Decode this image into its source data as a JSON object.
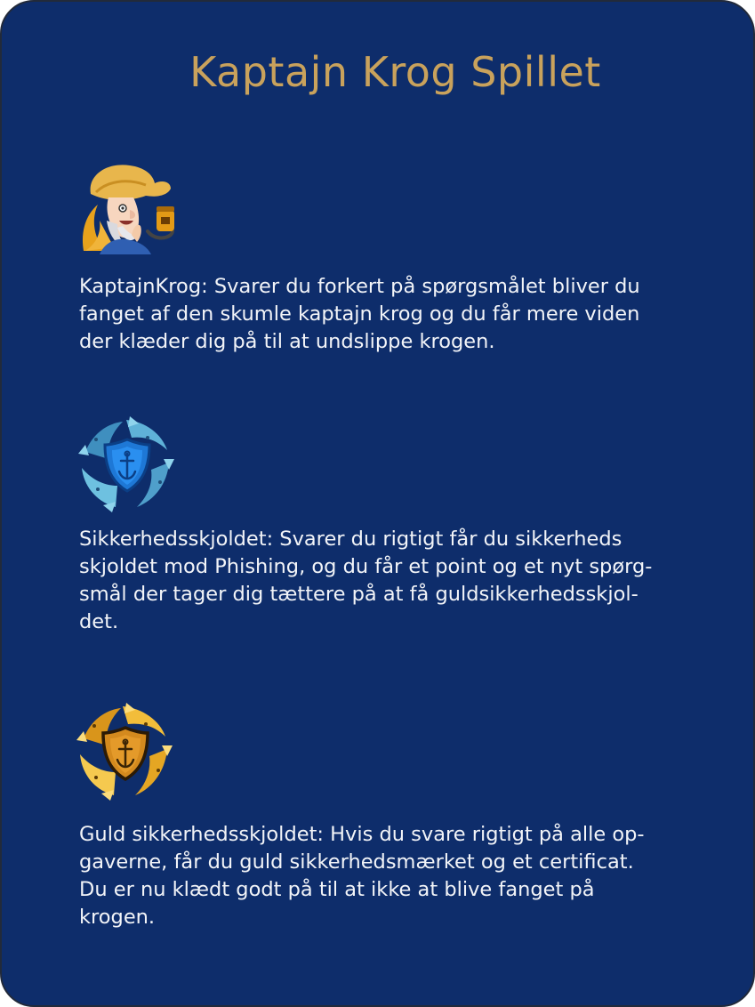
{
  "page": {
    "title": "Kaptajn Krog Spillet",
    "background_color": "#0e2d6b",
    "title_color": "#c9a25c"
  },
  "items": [
    {
      "icon": "captain-hook-pirate-icon",
      "lines": [
        "KaptajnKrog: Svarer du forkert på spørgsmålet bliver du",
        "fanget af den skumle kaptajn krog og du får mere viden",
        "der klæder dig på til at undslippe krogen."
      ]
    },
    {
      "icon": "blue-fish-shield-icon",
      "lines": [
        "Sikkerhedsskjoldet: Svarer du rigtigt får du sikkerheds",
        "skjoldet mod Phishing, og du får et point og et nyt spørg-",
        "smål der tager dig tættere på at få guldsikkerhedsskjol-",
        "det."
      ]
    },
    {
      "icon": "gold-fish-shield-icon",
      "lines": [
        "Guld sikkerhedsskjoldet: Hvis du svare rigtigt på alle op-",
        "gaverne, får du guld sikkerhedsmærket og et certificat.",
        "Du er nu klædt godt på til at ikke at blive fanget på",
        "krogen."
      ]
    }
  ]
}
